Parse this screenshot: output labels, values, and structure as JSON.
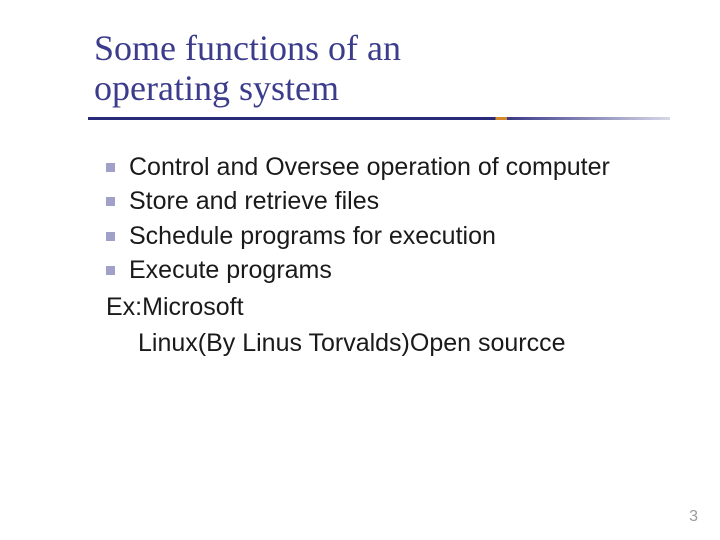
{
  "title_line1": "Some functions of an",
  "title_line2": "operating system",
  "bullets": [
    "Control and Oversee operation of computer",
    "Store and retrieve files",
    "Schedule programs for execution",
    "Execute programs"
  ],
  "extra1": "Ex:Microsoft",
  "extra2": "Linux(By Linus Torvalds)Open sourcce",
  "page_number": "3"
}
